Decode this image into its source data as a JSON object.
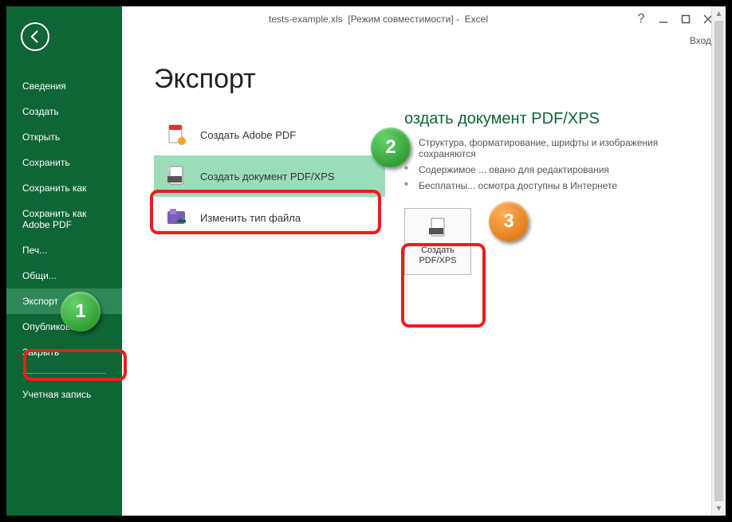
{
  "titlebar": {
    "filename": "tests-example.xls",
    "mode": "[Режим совместимости]",
    "appname": "Excel",
    "account": "Вход"
  },
  "sidebar": {
    "items": [
      "Сведения",
      "Создать",
      "Открыть",
      "Сохранить",
      "Сохранить как",
      "Сохранить как Adobe PDF",
      "Печ...",
      "Общи...",
      "Экспорт",
      "Опубликовать",
      "Закрыть"
    ],
    "account_item": "Учетная запись"
  },
  "page": {
    "title": "Экспорт",
    "options": [
      {
        "label": "Создать Adobe PDF",
        "icon": "adobe-pdf-icon"
      },
      {
        "label": "Создать документ PDF/XPS",
        "icon": "pdf-xps-icon"
      },
      {
        "label": "Изменить тип файла",
        "icon": "change-type-icon"
      }
    ]
  },
  "right": {
    "title_partial": "оздать документ PDF/XPS",
    "bullets": [
      "Структура, форматирование, шрифты и изображения сохраняются",
      "Содержимое ... овано для редактирования",
      "Бесплатны... осмотра доступны в Интернете"
    ],
    "button": "Создать PDF/XPS"
  },
  "callouts": {
    "one": "1",
    "two": "2",
    "three": "3"
  }
}
